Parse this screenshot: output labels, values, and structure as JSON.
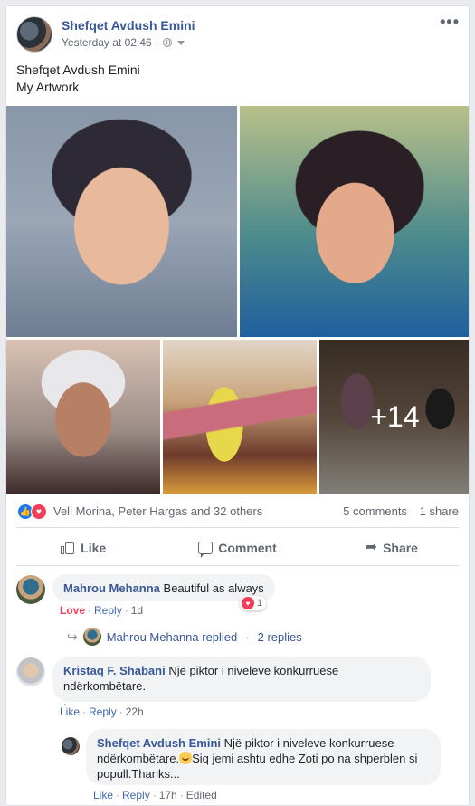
{
  "post": {
    "author": "Shefqet Avdush Emini",
    "time": "Yesterday at 02:46",
    "meta_sep": "·",
    "text_line1": "Shefqet Avdush Emini",
    "text_line2": "My Artwork",
    "more_label": "•••",
    "extra_photos": "+14"
  },
  "reactions": {
    "names": "Veli Morina, Peter Hargas and 32 others",
    "comments_count": "5 comments",
    "shares_count": "1 share"
  },
  "actions": {
    "like": "Like",
    "comment": "Comment",
    "share": "Share"
  },
  "comments": [
    {
      "name": "Mahrou Mehanna",
      "text": "Beautiful as always",
      "reaction_label": "Love",
      "reply_label": "Reply",
      "time": "1d",
      "reaction_count": "1",
      "replies_author": "Mahrou Mehanna replied",
      "replies_count": "2 replies"
    },
    {
      "name": "Kristaq F. Shabani",
      "text": "Një piktor i niveleve konkurruese ndërkombëtare.",
      "text_extra": ".",
      "like_label": "Like",
      "reply_label": "Reply",
      "time": "22h"
    },
    {
      "name": "Shefqet Avdush Emini",
      "text_a": "Një piktor i niveleve konkurruese ndërkombëtare.",
      "text_b": "Siq jemi ashtu edhe Zoti po na shperblen si popull.Thanks...",
      "like_label": "Like",
      "reply_label": "Reply",
      "time": "17h",
      "edited": "Edited"
    }
  ],
  "colors": {
    "link": "#385898",
    "love": "#f33e58",
    "like": "#1877f2"
  }
}
